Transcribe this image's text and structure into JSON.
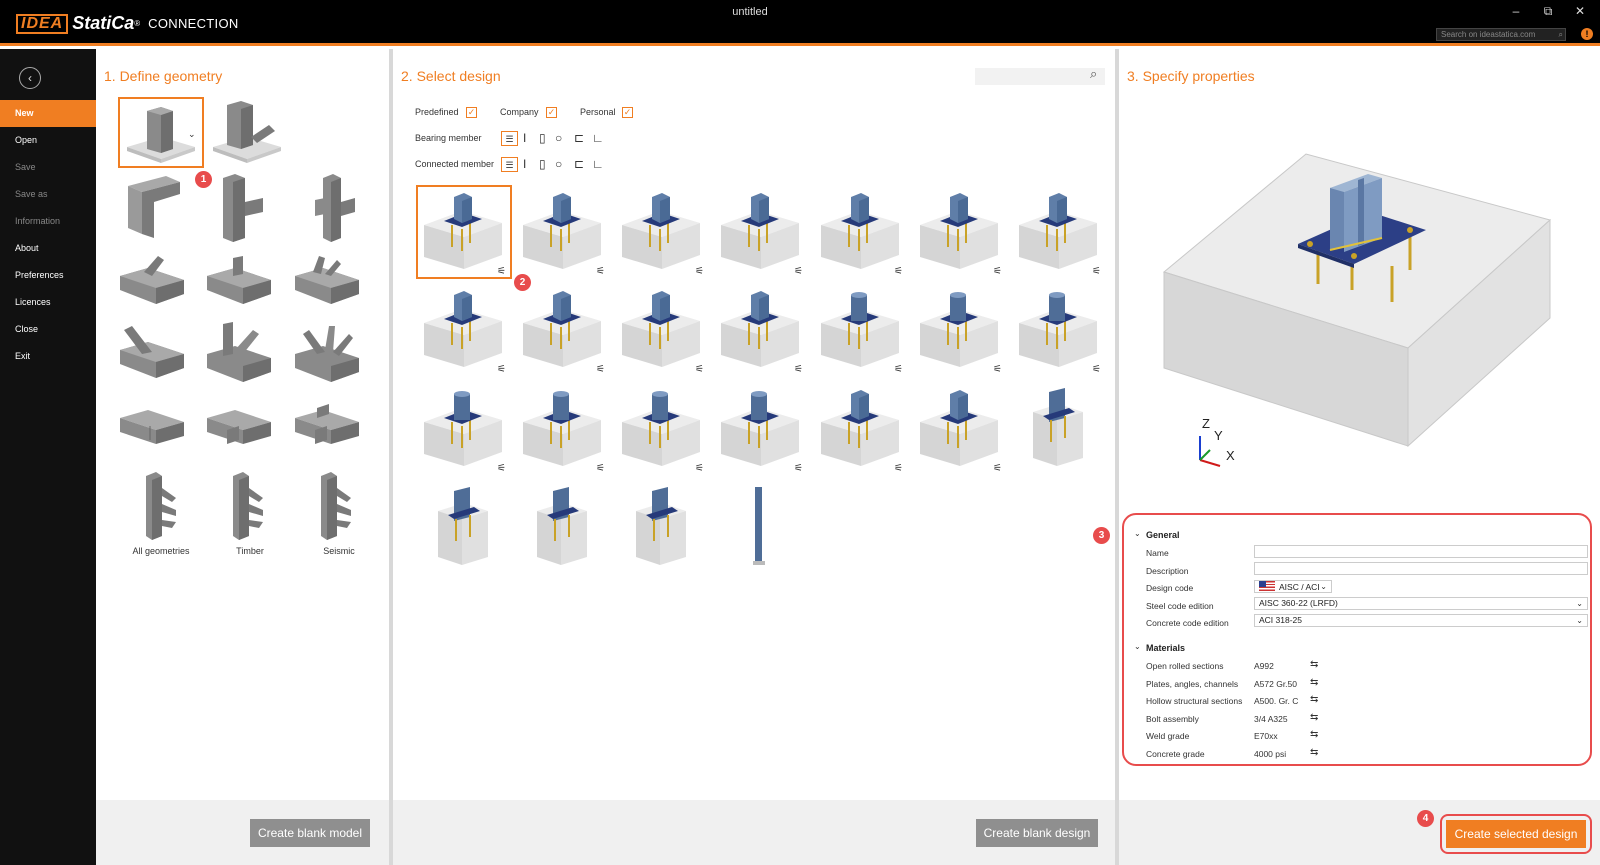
{
  "window": {
    "title": "untitled",
    "brand_idea": "IDEA",
    "brand_statica": "StatiCa",
    "brand_reg": "®",
    "product": "CONNECTION",
    "search_placeholder": "Search on ideastatica.com",
    "minimize": "–",
    "restore": "⧉",
    "close": "✕",
    "info": "!"
  },
  "sidebar": {
    "back": "‹",
    "items": [
      {
        "label": "New",
        "state": "active"
      },
      {
        "label": "Open",
        "state": "normal"
      },
      {
        "label": "Save",
        "state": "disabled"
      },
      {
        "label": "Save as",
        "state": "disabled"
      },
      {
        "label": "Information",
        "state": "disabled"
      },
      {
        "label": "About",
        "state": "normal"
      },
      {
        "label": "Preferences",
        "state": "normal"
      },
      {
        "label": "Licences",
        "state": "normal"
      },
      {
        "label": "Close",
        "state": "normal"
      },
      {
        "label": "Exit",
        "state": "normal"
      }
    ]
  },
  "geometry": {
    "title": "1. Define geometry",
    "labels": [
      "All geometries",
      "Timber",
      "Seismic"
    ],
    "button": "Create blank model",
    "badge": "1"
  },
  "design": {
    "title": "2. Select design",
    "filters": {
      "predefined": "Predefined",
      "company": "Company",
      "personal": "Personal"
    },
    "bearing_member": "Bearing member",
    "connected_member": "Connected member",
    "check": "✓",
    "button": "Create blank design",
    "badge": "2"
  },
  "properties": {
    "title": "3. Specify properties",
    "badge": "3",
    "axes": {
      "z": "Z",
      "y": "Y",
      "x": "X"
    },
    "general": {
      "heading": "General",
      "name_label": "Name",
      "name_value": "",
      "description_label": "Description",
      "description_value": "",
      "design_code_label": "Design code",
      "design_code_value": "AISC / ACI",
      "steel_code_label": "Steel code edition",
      "steel_code_value": "AISC 360-22 (LRFD)",
      "concrete_code_label": "Concrete code edition",
      "concrete_code_value": "ACI 318-25"
    },
    "materials": {
      "heading": "Materials",
      "rows": [
        {
          "label": "Open rolled sections",
          "value": "A992"
        },
        {
          "label": "Plates, angles, channels",
          "value": "A572 Gr.50"
        },
        {
          "label": "Hollow structural sections",
          "value": "A500. Gr. C"
        },
        {
          "label": "Bolt assembly",
          "value": "3/4 A325"
        },
        {
          "label": "Weld grade",
          "value": "E70xx"
        },
        {
          "label": "Concrete grade",
          "value": "4000 psi"
        }
      ]
    },
    "button": "Create selected design",
    "button_badge": "4"
  },
  "colors": {
    "accent": "#f07e22",
    "badge": "#e84c4c",
    "steel": "#3f5f8a",
    "concrete": "#d9d9d9"
  }
}
